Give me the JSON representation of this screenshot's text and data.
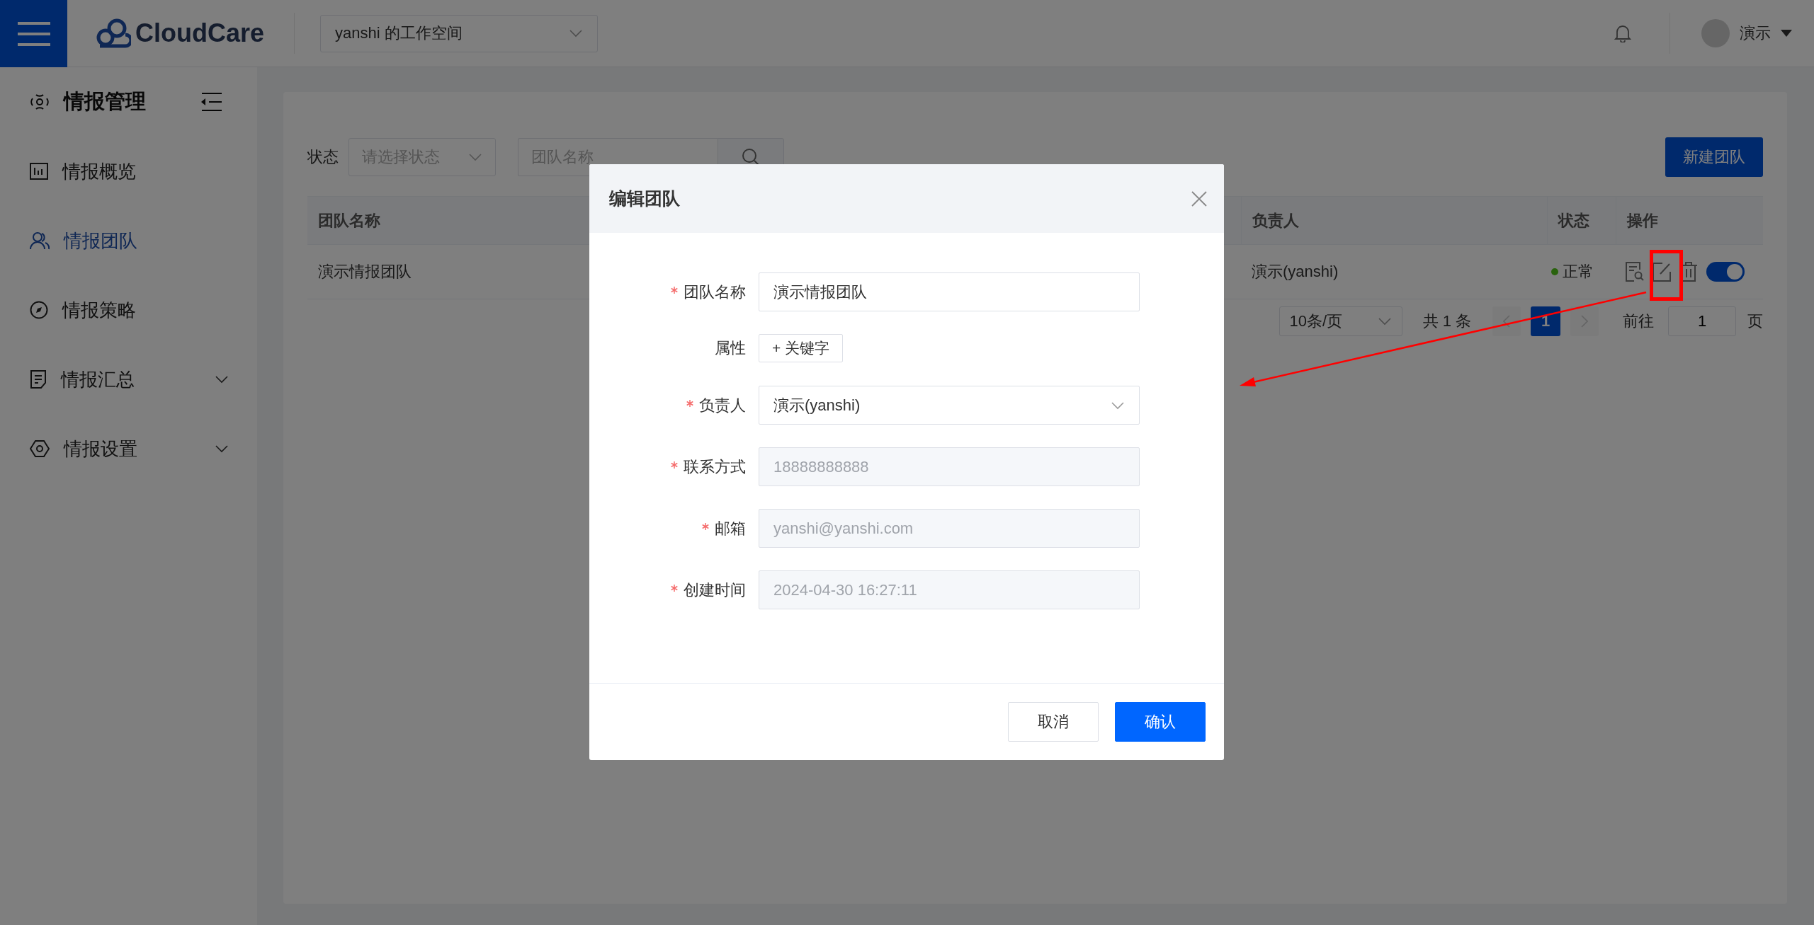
{
  "top_bar": {
    "brand": "CloudCare",
    "workspace": "yanshi 的工作空间",
    "user": "演示"
  },
  "sidebar": {
    "title": "情报管理",
    "items": [
      {
        "label": "情报概览",
        "kind": "overview",
        "selected": false,
        "expandable": false
      },
      {
        "label": "情报团队",
        "kind": "team",
        "selected": true,
        "expandable": false
      },
      {
        "label": "情报策略",
        "kind": "strategy",
        "selected": false,
        "expandable": false
      },
      {
        "label": "情报汇总",
        "kind": "summary",
        "selected": false,
        "expandable": true
      },
      {
        "label": "情报设置",
        "kind": "settings",
        "selected": false,
        "expandable": true
      }
    ]
  },
  "filters": {
    "status_label": "状态",
    "status_placeholder": "请选择状态",
    "search_placeholder": "团队名称",
    "new_button": "新建团队"
  },
  "table": {
    "columns": [
      "团队名称",
      "负责人",
      "状态",
      "操作"
    ],
    "rows": [
      {
        "name": "演示情报团队",
        "owner": "演示(yanshi)",
        "status": "正常",
        "enabled": true
      }
    ]
  },
  "pagination": {
    "page_size": "10条/页",
    "total": "共 1 条",
    "pages": [
      {
        "label": "1",
        "selected": true
      }
    ],
    "goto_label": "前往",
    "goto_value": "1",
    "page_suffix": "页"
  },
  "dialog": {
    "title": "编辑团队",
    "fields": [
      {
        "kind": "input",
        "label": "团队名称",
        "required": true,
        "value": "演示情报团队",
        "disabled": false
      },
      {
        "kind": "tag_button",
        "label": "属性",
        "required": false,
        "button": "+ 关键字"
      },
      {
        "kind": "select",
        "label": "负责人",
        "required": true,
        "value": "演示(yanshi)"
      },
      {
        "kind": "input",
        "label": "联系方式",
        "required": true,
        "value": "18888888888",
        "disabled": true
      },
      {
        "kind": "input",
        "label": "邮箱",
        "required": true,
        "value": "yanshi@yanshi.com",
        "disabled": true
      },
      {
        "kind": "input",
        "label": "创建时间",
        "required": true,
        "value": "2024-04-30 16:27:11",
        "disabled": true
      }
    ],
    "buttons": [
      {
        "label": "取消",
        "kind": "default"
      },
      {
        "label": "确认",
        "kind": "primary"
      }
    ]
  }
}
